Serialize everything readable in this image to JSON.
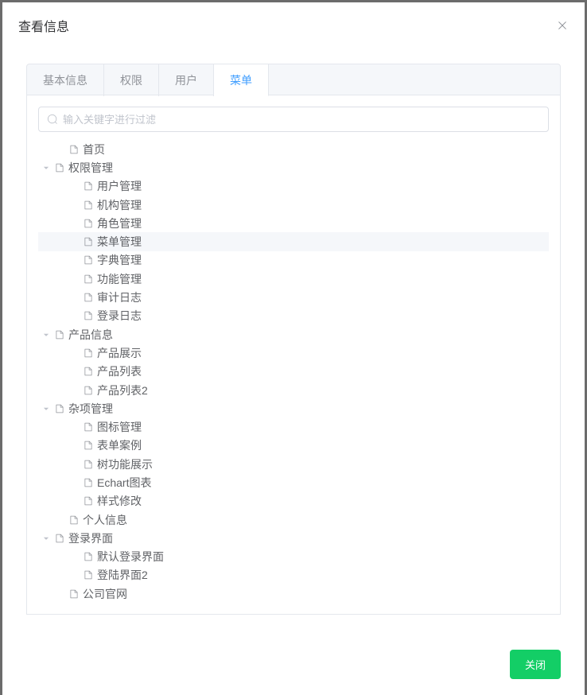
{
  "modal": {
    "title": "查看信息",
    "close_button": "关闭"
  },
  "tabs": [
    {
      "label": "基本信息",
      "active": false
    },
    {
      "label": "权限",
      "active": false
    },
    {
      "label": "用户",
      "active": false
    },
    {
      "label": "菜单",
      "active": true
    }
  ],
  "search": {
    "placeholder": "输入关键字进行过滤"
  },
  "tree": [
    {
      "label": "首页",
      "level": 1,
      "leaf": true
    },
    {
      "label": "权限管理",
      "level": 0,
      "leaf": false,
      "expanded": true
    },
    {
      "label": "用户管理",
      "level": 2,
      "leaf": true
    },
    {
      "label": "机构管理",
      "level": 2,
      "leaf": true
    },
    {
      "label": "角色管理",
      "level": 2,
      "leaf": true
    },
    {
      "label": "菜单管理",
      "level": 2,
      "leaf": true,
      "highlighted": true
    },
    {
      "label": "字典管理",
      "level": 2,
      "leaf": true
    },
    {
      "label": "功能管理",
      "level": 2,
      "leaf": true
    },
    {
      "label": "审计日志",
      "level": 2,
      "leaf": true
    },
    {
      "label": "登录日志",
      "level": 2,
      "leaf": true
    },
    {
      "label": "产品信息",
      "level": 0,
      "leaf": false,
      "expanded": true
    },
    {
      "label": "产品展示",
      "level": 2,
      "leaf": true
    },
    {
      "label": "产品列表",
      "level": 2,
      "leaf": true
    },
    {
      "label": "产品列表2",
      "level": 2,
      "leaf": true
    },
    {
      "label": "杂项管理",
      "level": 0,
      "leaf": false,
      "expanded": true
    },
    {
      "label": "图标管理",
      "level": 2,
      "leaf": true
    },
    {
      "label": "表单案例",
      "level": 2,
      "leaf": true
    },
    {
      "label": "树功能展示",
      "level": 2,
      "leaf": true
    },
    {
      "label": "Echart图表",
      "level": 2,
      "leaf": true
    },
    {
      "label": "样式修改",
      "level": 2,
      "leaf": true
    },
    {
      "label": "个人信息",
      "level": 1,
      "leaf": true
    },
    {
      "label": "登录界面",
      "level": 0,
      "leaf": false,
      "expanded": true
    },
    {
      "label": "默认登录界面",
      "level": 2,
      "leaf": true
    },
    {
      "label": "登陆界面2",
      "level": 2,
      "leaf": true
    },
    {
      "label": "公司官网",
      "level": 1,
      "leaf": true
    }
  ]
}
